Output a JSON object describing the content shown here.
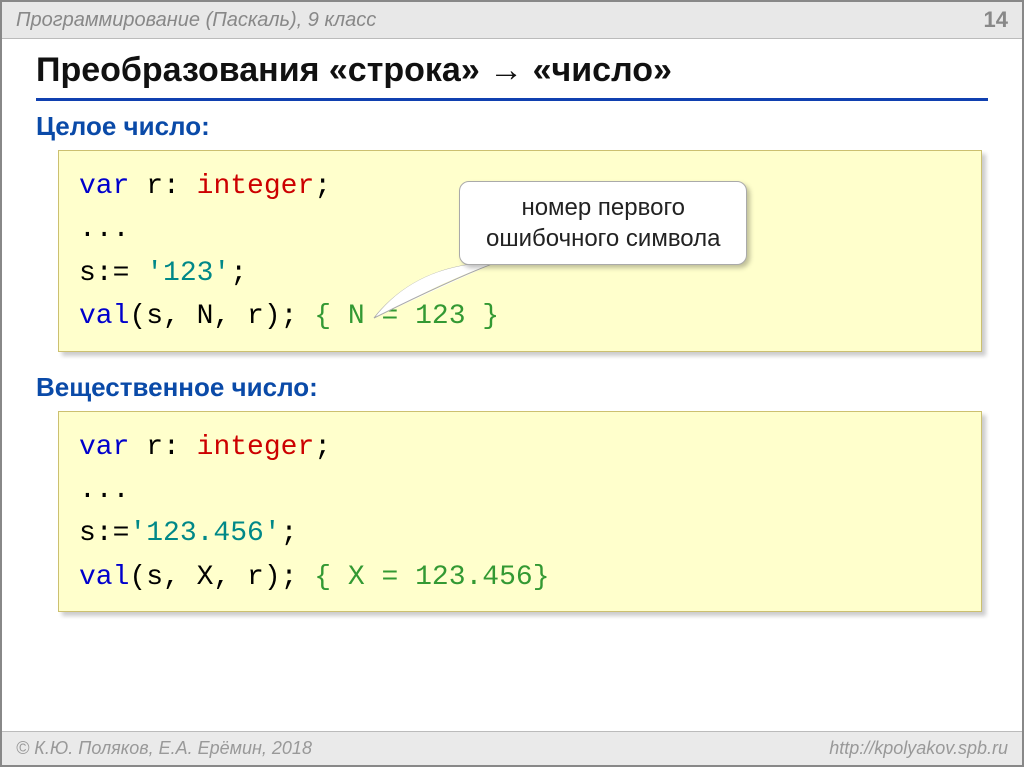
{
  "header": {
    "course": "Программирование (Паскаль), 9 класс",
    "page_num": "14"
  },
  "title": "Преобразования «строка» → «число»",
  "section1": {
    "heading": "Целое число:",
    "code": {
      "l1_var": "var",
      "l1_r": " r: ",
      "l1_type": "integer",
      "l1_semi": ";",
      "l2": "...",
      "l3_s": "s:= ",
      "l3_lit": "'123'",
      "l3_semi": ";",
      "l4_val": "val",
      "l4_args": "(s, N, r); ",
      "l4_comment": "{ N = 123 }"
    },
    "callout_l1": "номер первого",
    "callout_l2": "ошибочного символа"
  },
  "section2": {
    "heading": "Вещественное число:",
    "code": {
      "l1_var": "var",
      "l1_r": " r: ",
      "l1_type": "integer",
      "l1_semi": ";",
      "l2": "...",
      "l3_s": "s:=",
      "l3_lit": "'123.456'",
      "l3_semi": ";",
      "l4_val": "val",
      "l4_args": "(s, X, r); ",
      "l4_comment": "{ X = 123.456}"
    }
  },
  "footer": {
    "authors": "© К.Ю. Поляков, Е.А. Ерёмин, 2018",
    "url": "http://kpolyakov.spb.ru"
  }
}
